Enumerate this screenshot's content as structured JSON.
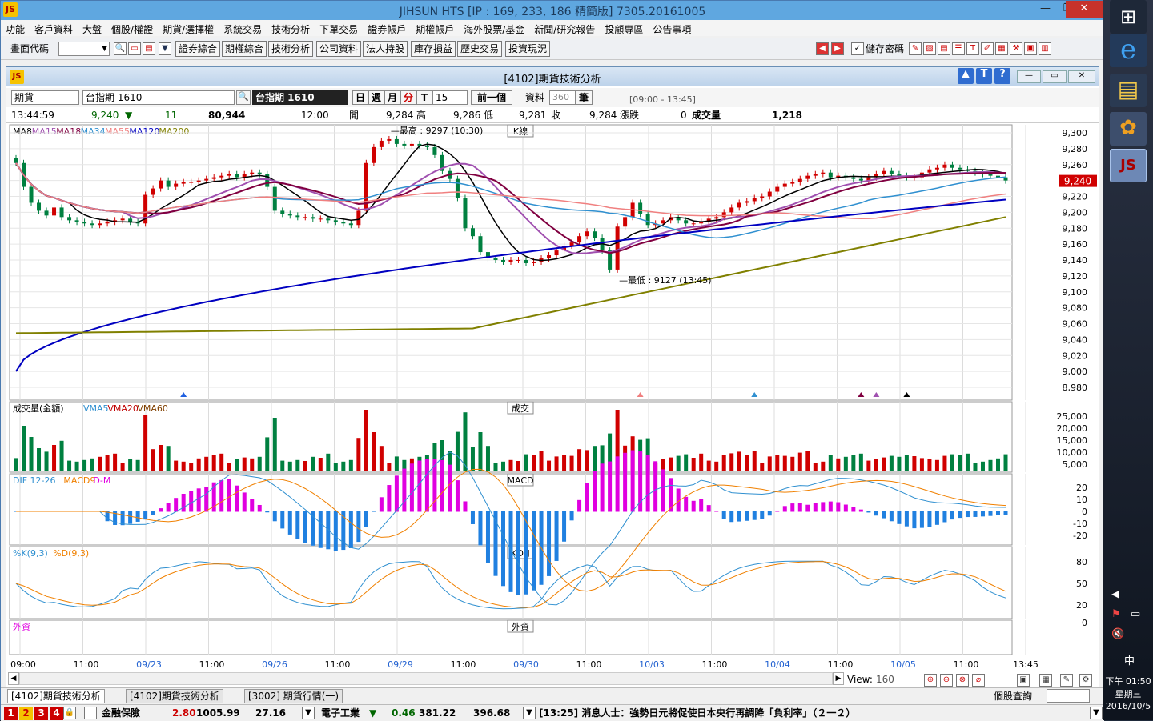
{
  "window": {
    "title": "JIHSUN HTS  [IP : 169, 233, 186 精簡版] 7305.20161005",
    "minimize": "—",
    "restore": "❐",
    "close": "✕"
  },
  "menu": [
    "功能",
    "客戶資料",
    "大盤",
    "個股/權證",
    "期貨/選擇權",
    "系統交易",
    "技術分析",
    "下單交易",
    "證券帳戶",
    "期權帳戶",
    "海外股票/基金",
    "新聞/研究報告",
    "投顧專區",
    "公告事項"
  ],
  "toolbar": {
    "code_label": "畫面代碼",
    "buttons": [
      "證券綜合",
      "期權綜合",
      "技術分析",
      "公司資料",
      "法人持股",
      "庫存損益",
      "歷史交易",
      "投資現況"
    ],
    "save_pwd": "儲存密碼"
  },
  "inner": {
    "title": "[4102]期貨技術分析",
    "type": "期貨",
    "symbol": "台指期 1610",
    "symbol_name": "台指期 1610",
    "periods": [
      "日",
      "週",
      "月",
      "分",
      "T"
    ],
    "active_period": "分",
    "minutes": "15",
    "prev": "前一個",
    "data_label": "資料",
    "data_count": "360",
    "data_unit": "筆",
    "session": "[09:00 - 13:45]"
  },
  "quote": {
    "time": "13:44:59",
    "price": "9,240",
    "change": "11",
    "volume": "80,944",
    "clock": "12:00",
    "open_l": "開",
    "open": "9,284",
    "high_l": "高",
    "high": "9,286",
    "low_l": "低",
    "low": "9,281",
    "close_l": "收",
    "close": "9,284",
    "chg_l": "漲跌",
    "chg": "0",
    "vol_l": "成交量",
    "vol": "1,218"
  },
  "panels": {
    "k": {
      "title": "K線",
      "legend": [
        {
          "t": "MA8",
          "c": "#000000"
        },
        {
          "t": "MA15",
          "c": "#a050b0"
        },
        {
          "t": "MA18",
          "c": "#800040"
        },
        {
          "t": "MA34",
          "c": "#3090d0"
        },
        {
          "t": "MA55",
          "c": "#f08080"
        },
        {
          "t": "MA120",
          "c": "#0000c0"
        },
        {
          "t": "MA200",
          "c": "#808000"
        }
      ],
      "yticks": [
        "9,300",
        "9,280",
        "9,260",
        "9,240",
        "9,220",
        "9,200",
        "9,180",
        "9,160",
        "9,140",
        "9,120",
        "9,100",
        "9,080",
        "9,060",
        "9,040",
        "9,020",
        "9,000",
        "8,980"
      ],
      "ylim": [
        8980,
        9300
      ],
      "high_note": "最高 : 9297 (10:30)",
      "low_note": "最低 : 9127 (13:45)",
      "last": "9,240"
    },
    "vol": {
      "title": "成交",
      "legend": [
        {
          "t": "成交量(金額)",
          "c": "#000000"
        },
        {
          "t": "VMA5",
          "c": "#3090d0"
        },
        {
          "t": "VMA20",
          "c": "#c00000"
        },
        {
          "t": "VMA60",
          "c": "#804000"
        }
      ],
      "yticks": [
        "25,000",
        "20,000",
        "15,000",
        "10,000",
        "5,000"
      ]
    },
    "macd": {
      "title": "MACD",
      "legend": [
        {
          "t": "DIF 12-26",
          "c": "#3090d0"
        },
        {
          "t": "MACD9",
          "c": "#f08000"
        },
        {
          "t": "D-M",
          "c": "#e000e0"
        }
      ],
      "yticks": [
        "20",
        "10",
        "0",
        "-10",
        "-20"
      ]
    },
    "kd": {
      "title": "KD-J",
      "legend": [
        {
          "t": "%K(9,3)",
          "c": "#3090d0"
        },
        {
          "t": "%D(9,3)",
          "c": "#f08000"
        }
      ],
      "yticks": [
        "80",
        "50",
        "20"
      ]
    },
    "foreign": {
      "title": "外資",
      "legend": [
        {
          "t": "外資",
          "c": "#e000e0"
        }
      ],
      "yticks": [
        "0",
        "0"
      ]
    }
  },
  "xaxis": [
    {
      "t": "09:00",
      "b": false
    },
    {
      "t": "11:00",
      "b": false
    },
    {
      "t": "09/23",
      "b": true
    },
    {
      "t": "11:00",
      "b": false
    },
    {
      "t": "09/26",
      "b": true
    },
    {
      "t": "11:00",
      "b": false
    },
    {
      "t": "09/29",
      "b": true
    },
    {
      "t": "11:00",
      "b": false
    },
    {
      "t": "09/30",
      "b": true
    },
    {
      "t": "11:00",
      "b": false
    },
    {
      "t": "10/03",
      "b": true
    },
    {
      "t": "11:00",
      "b": false
    },
    {
      "t": "10/04",
      "b": true
    },
    {
      "t": "11:00",
      "b": false
    },
    {
      "t": "10/05",
      "b": true
    },
    {
      "t": "11:00",
      "b": false
    },
    {
      "t": "13:45",
      "b": false
    }
  ],
  "view": {
    "label": "View:",
    "value": "160"
  },
  "tabs": [
    "[4102]期貨技術分析",
    "[4102]期貨技術分析",
    "[3002] 期貨行情(一)"
  ],
  "tabs_right": "個股查詢",
  "status": {
    "nums": [
      "1",
      "2",
      "3",
      "4"
    ],
    "i1": "金融保險",
    "v1": "2.80",
    "p1": "1005.99",
    "x1": "27.16",
    "i2": "電子工業",
    "v2": "0.46",
    "p2": "381.22",
    "x2": "396.68",
    "news": "[13:25] 消息人士：強勢日元將促使日本央行再調降「負利率」（２一２）"
  },
  "taskbar": {
    "ime": "中",
    "time": "下午 01:50",
    "weekday": "星期三",
    "date": "2016/10/5"
  },
  "chart_data": {
    "type": "candlestick",
    "title": "K線",
    "x_range": [
      "09/22 09:00",
      "10/05 13:45"
    ],
    "ylim": [
      8980,
      9300
    ],
    "high": 9297,
    "low": 9127,
    "last": 9240,
    "close": [
      9262,
      9232,
      9212,
      9202,
      9196,
      9206,
      9194,
      9190,
      9188,
      9186,
      9184,
      9186,
      9188,
      9190,
      9192,
      9188,
      9186,
      9222,
      9230,
      9240,
      9232,
      9236,
      9238,
      9238,
      9240,
      9242,
      9244,
      9246,
      9248,
      9244,
      9248,
      9250,
      9248,
      9232,
      9202,
      9198,
      9196,
      9194,
      9194,
      9192,
      9192,
      9190,
      9188,
      9186,
      9184,
      9202,
      9262,
      9282,
      9290,
      9292,
      9286,
      9284,
      9286,
      9284,
      9282,
      9272,
      9252,
      9242,
      9218,
      9180,
      9170,
      9150,
      9142,
      9140,
      9138,
      9140,
      9140,
      9136,
      9138,
      9142,
      9146,
      9152,
      9158,
      9162,
      9170,
      9176,
      9168,
      9152,
      9128,
      9182,
      9194,
      9212,
      9198,
      9184,
      9186,
      9190,
      9194,
      9190,
      9186,
      9186,
      9188,
      9192,
      9194,
      9200,
      9206,
      9212,
      9214,
      9218,
      9220,
      9226,
      9232,
      9236,
      9238,
      9242,
      9246,
      9248,
      9250,
      9244,
      9246,
      9244,
      9242,
      9240,
      9244,
      9248,
      9252,
      9248,
      9246,
      9244,
      9244,
      9250,
      9254,
      9256,
      9260,
      9256,
      9254,
      9252,
      9250,
      9248,
      9246,
      9244,
      9240
    ],
    "MA120_start": 9000,
    "MA120_end": 9216,
    "MA200_start": 9048,
    "MA200_end": 9194
  }
}
